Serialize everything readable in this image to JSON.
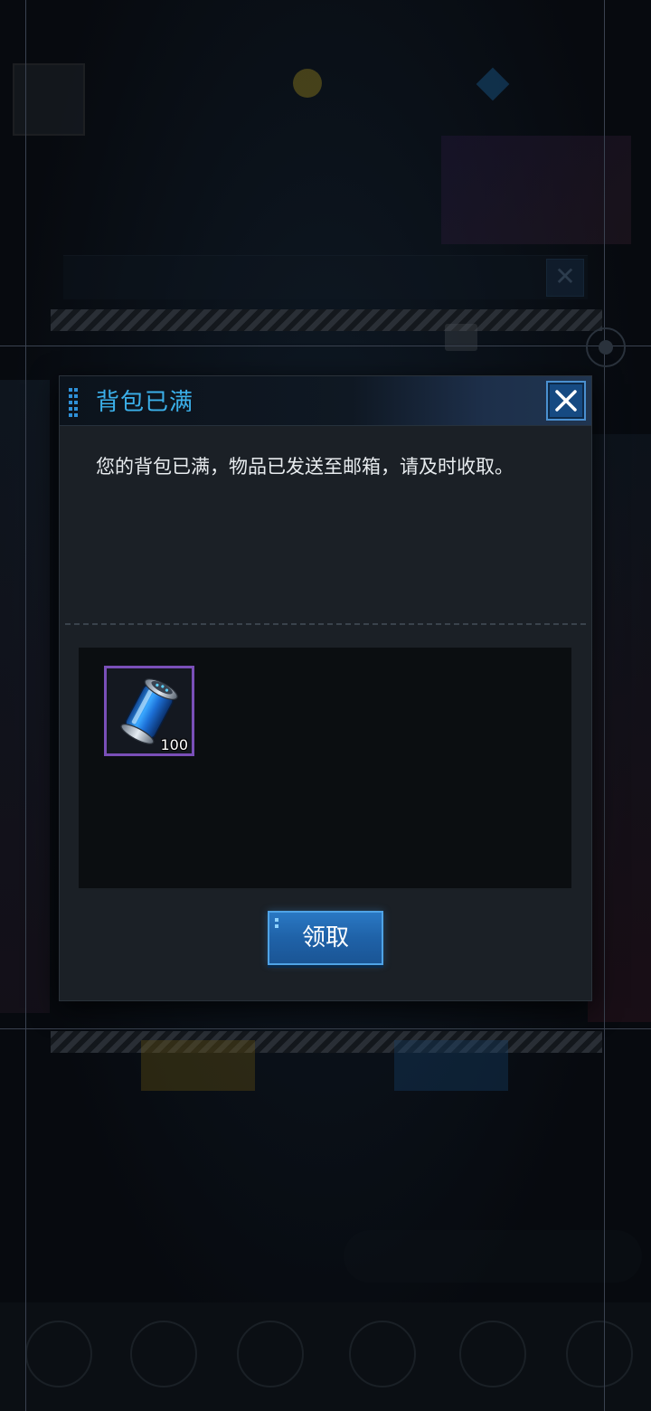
{
  "dialog": {
    "title": "背包已满",
    "message": "您的背包已满，物品已发送至邮箱，请及时收取。",
    "claim_label": "领取",
    "close_icon": "close-icon"
  },
  "items": [
    {
      "icon": "energy-canister-icon",
      "quantity": "100",
      "rarity_color": "#7a4fb8"
    }
  ],
  "colors": {
    "title": "#3bb0ea",
    "accent_blue": "#1f62a8",
    "dialog_bg": "#1b2026"
  }
}
